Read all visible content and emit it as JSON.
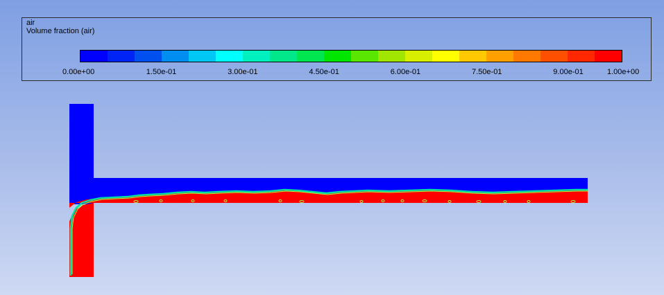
{
  "legend": {
    "title": "air",
    "subtitle": "Volume fraction (air)",
    "ticks": [
      "0.00e+00",
      "1.50e-01",
      "3.00e-01",
      "4.50e-01",
      "6.00e-01",
      "7.50e-01",
      "9.00e-01",
      "1.00e+00"
    ],
    "tick_values": [
      0,
      0.15,
      0.3,
      0.45,
      0.6,
      0.75,
      0.9,
      1.0
    ],
    "colors": [
      "#0000ff",
      "#0024f5",
      "#0050f0",
      "#008ff0",
      "#00c8f5",
      "#00ffff",
      "#00f0c0",
      "#00e88a",
      "#00e650",
      "#00e600",
      "#5ae600",
      "#a0e600",
      "#d8f000",
      "#ffff00",
      "#ffc800",
      "#ffa000",
      "#ff7800",
      "#ff5000",
      "#ff2800",
      "#ff0000"
    ],
    "range": [
      0,
      1
    ]
  },
  "domain": {
    "colors": {
      "air": "#0000ff",
      "water": "#ff0000",
      "interface": "#00e0a0",
      "interface_edge": "#a0ff40"
    }
  }
}
